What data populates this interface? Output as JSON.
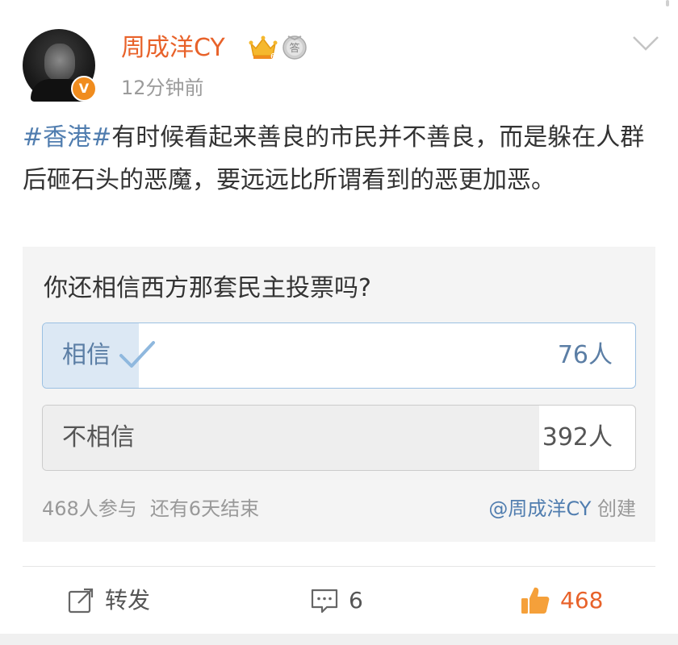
{
  "post": {
    "author": {
      "name": "周成洋CY",
      "verified_badge": "V",
      "crown_level": "6",
      "crown_icon": "crown-icon",
      "medal_icon": "medal-icon",
      "medal_label": "答"
    },
    "timestamp": "12分钟前",
    "hashtag": "#香港#",
    "text": "有时候看起来善良的市民并不善良，而是躲在人群后砸石头的恶魔，要远远比所谓看到的恶更加恶。"
  },
  "poll": {
    "question": "你还相信西方那套民主投票吗?",
    "options": [
      {
        "label": "相信",
        "count_label": "76人",
        "votes": 76,
        "selected": true
      },
      {
        "label": "不相信",
        "count_label": "392人",
        "votes": 392,
        "selected": false
      }
    ],
    "participants": "468人参与",
    "time_left": "还有6天结束",
    "creator": "@周成洋CY",
    "created_label": "创建"
  },
  "actions": {
    "repost_label": "转发",
    "comment_count": "6",
    "like_count": "468"
  },
  "colors": {
    "accent_orange": "#e8622a",
    "link_blue": "#507daf",
    "selected_fill": "#dce8f4",
    "unselected_fill": "#eeeeee"
  }
}
